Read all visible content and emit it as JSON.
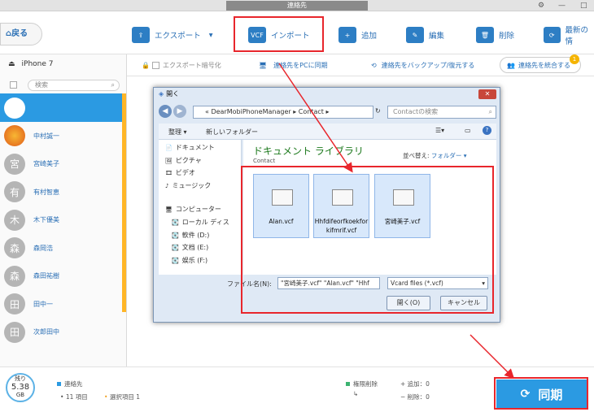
{
  "window": {
    "title": "連絡先",
    "controls": {
      "settings": "⚙",
      "minimize": "—",
      "maximize": "□"
    }
  },
  "toolbar": {
    "back": "戻る",
    "export": "エクスポート",
    "import": "インポート",
    "add": "追加",
    "edit": "編集",
    "delete": "削除",
    "latest": "最新の情"
  },
  "subbar": {
    "export_password": "エクスポート暗号化",
    "sync_pc": "連絡先をPCに同期",
    "backup": "連絡先をバックアップ/復元する",
    "merge": "連絡先を統合する",
    "merge_badge": "1"
  },
  "sidebar": {
    "device": "iPhone 7",
    "search_placeholder": "検索",
    "contacts": [
      {
        "avatar": "",
        "name": ""
      },
      {
        "avatar": "",
        "name": "中村誠一"
      },
      {
        "avatar": "宮",
        "name": "宮崎美子"
      },
      {
        "avatar": "有",
        "name": "有村智恵"
      },
      {
        "avatar": "木",
        "name": "木下優美"
      },
      {
        "avatar": "森",
        "name": "森岡浩"
      },
      {
        "avatar": "森",
        "name": "森田祐樹"
      },
      {
        "avatar": "田",
        "name": "田中一"
      },
      {
        "avatar": "田",
        "name": "次郎田中"
      }
    ]
  },
  "footer": {
    "storage_label": "残り",
    "storage_value": "5.38",
    "storage_unit": "GB",
    "contacts_label": "連絡先",
    "items": "11 項目",
    "selected": "選択項目 1",
    "perm_delete": "権限削除",
    "added": "追加：0",
    "deleted": "削除：0",
    "sync": "同期"
  },
  "dialog": {
    "title": "開く",
    "close": "✕",
    "path_root": "«",
    "path_1": "DearMobiPhoneManager",
    "path_2": "Contact",
    "search_placeholder": "Contactの検索",
    "organize": "整理 ▾",
    "new_folder": "新しいフォルダー",
    "nav": [
      "ドキュメント",
      "ピクチャ",
      "ビデオ",
      "ミュージック",
      "コンピューター",
      "ローカル ディス",
      "軟件 (D:)",
      "文档 (E:)",
      "娱乐 (F:)"
    ],
    "library_title": "ドキュメント ライブラリ",
    "library_sub": "Contact",
    "sort_label": "並べ替え:",
    "sort_value": "フォルダー ▾",
    "files": [
      "Alan.vcf",
      "Hhfdifeorfkoekforkifmrif.vcf",
      "宮崎美子.vcf"
    ],
    "filename_label": "ファイル名(N):",
    "filename_value": "\"宮崎美子.vcf\" \"Alan.vcf\" \"Hhf",
    "filetype": "Vcard files (*.vcf)",
    "open": "開く(O)",
    "cancel": "キャンセル"
  },
  "colors": {
    "accent": "#2b9ae2",
    "highlight": "#e8262c",
    "scroll": "#ffb627"
  }
}
